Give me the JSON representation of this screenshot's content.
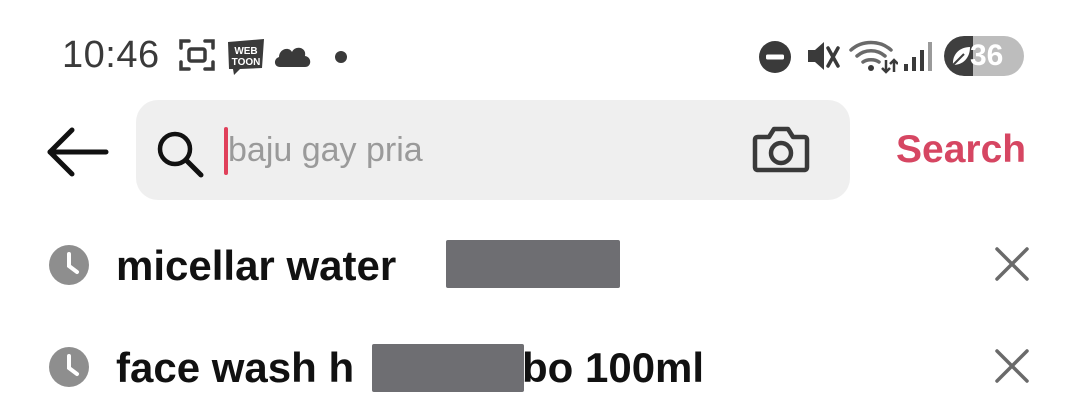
{
  "status_bar": {
    "time": "10:46",
    "battery_level": "36",
    "icons": [
      "screenshot-icon",
      "webtoon-app-icon",
      "cloud-icon",
      "notification-dot-icon",
      "do-not-disturb-icon",
      "mute-icon",
      "wifi-icon",
      "signal-icon",
      "battery-saver-icon"
    ]
  },
  "search": {
    "placeholder": "baju gay pria",
    "value": "",
    "submit_label": "Search",
    "accent_color": "#d64662",
    "icons": [
      "back-arrow-icon",
      "search-icon",
      "camera-icon"
    ]
  },
  "recent_searches": [
    {
      "text_visible": "micellar water ",
      "has_redaction": true,
      "icon": "clock-icon",
      "remove_icon": "close-icon"
    },
    {
      "text_visible": "face wash h",
      "text_after_redaction": "bo 100ml",
      "has_redaction": true,
      "icon": "clock-icon",
      "remove_icon": "close-icon"
    }
  ]
}
